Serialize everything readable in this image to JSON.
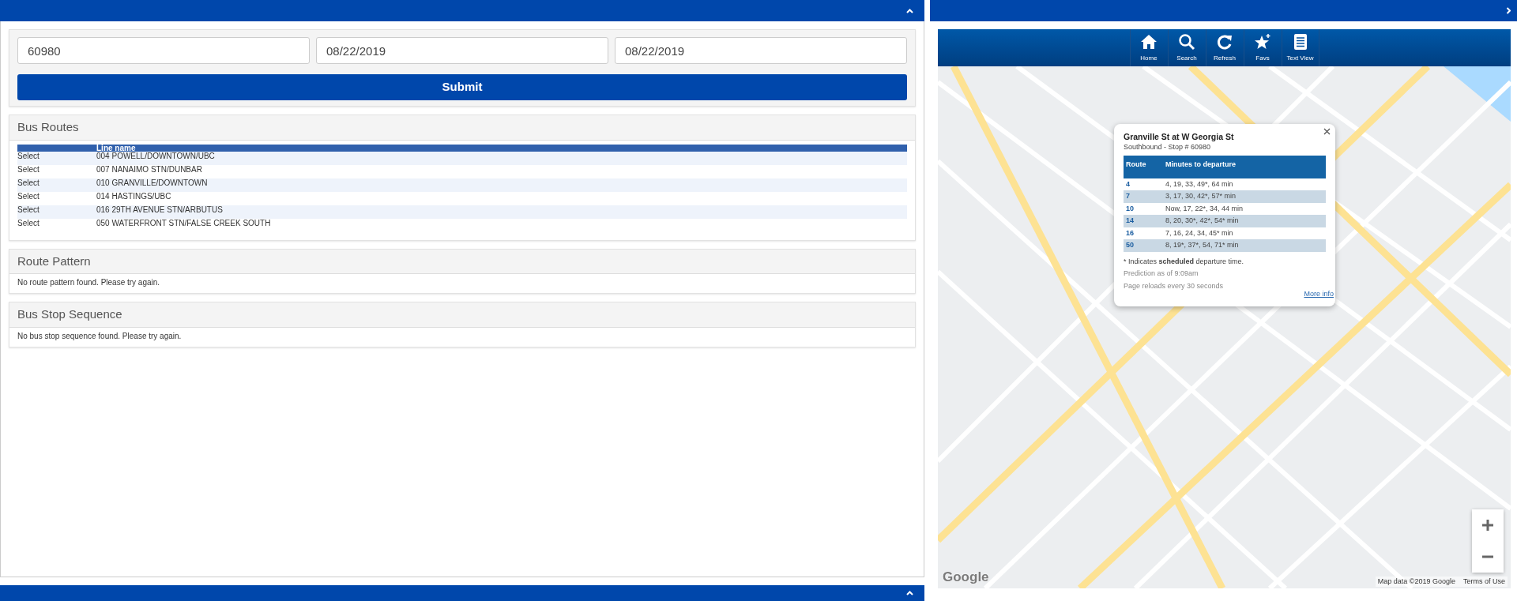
{
  "search_form": {
    "stop_number": "60980",
    "start_date": "08/22/2019",
    "end_date": "08/22/2019",
    "submit": "Submit"
  },
  "bus_routes": {
    "title": "Bus Routes",
    "columns": [
      "",
      "Line name"
    ],
    "rows": [
      {
        "action": "Select",
        "line": "004 POWELL/DOWNTOWN/UBC"
      },
      {
        "action": "Select",
        "line": "007 NANAIMO STN/DUNBAR"
      },
      {
        "action": "Select",
        "line": "010 GRANVILLE/DOWNTOWN"
      },
      {
        "action": "Select",
        "line": "014 HASTINGS/UBC"
      },
      {
        "action": "Select",
        "line": "016 29TH AVENUE STN/ARBUTUS"
      },
      {
        "action": "Select",
        "line": "050 WATERFRONT STN/FALSE CREEK SOUTH"
      }
    ]
  },
  "route_pattern": {
    "title": "Route Pattern",
    "message": "No route pattern found. Please try again."
  },
  "bus_stop_sequence": {
    "title": "Bus Stop Sequence",
    "message": "No bus stop sequence found. Please try again."
  },
  "map_toolbar": [
    {
      "kind": "home",
      "label": "Home"
    },
    {
      "kind": "search",
      "label": "Search"
    },
    {
      "kind": "refresh",
      "label": "Refresh"
    },
    {
      "kind": "favs",
      "label": "Favs"
    },
    {
      "kind": "list",
      "label": "Text View"
    }
  ],
  "stop_popup": {
    "title": "Granville St at W Georgia St",
    "subtitle": "Southbound - Stop # 60980",
    "columns": [
      "Route",
      "Minutes to departure"
    ],
    "rows": [
      {
        "route": "4",
        "times": "4, 19, 33, 49*, 64 min"
      },
      {
        "route": "7",
        "times": "3, 17, 30, 42*, 57* min"
      },
      {
        "route": "10",
        "times": "Now, 17, 22*, 34, 44 min"
      },
      {
        "route": "14",
        "times": "8, 20, 30*, 42*, 54* min"
      },
      {
        "route": "16",
        "times": "7, 16, 24, 34, 45* min"
      },
      {
        "route": "50",
        "times": "8, 19*, 37*, 54, 71* min"
      }
    ],
    "footnote": "* Indicates **scheduled** departure time.",
    "prediction": "Prediction as of 9:09am",
    "reload": "Page reloads every 30 seconds",
    "more_info": "More info"
  },
  "map_footer": {
    "logo": "Google",
    "attribution": "Map data ©2019 Google",
    "terms": "Terms of Use"
  }
}
